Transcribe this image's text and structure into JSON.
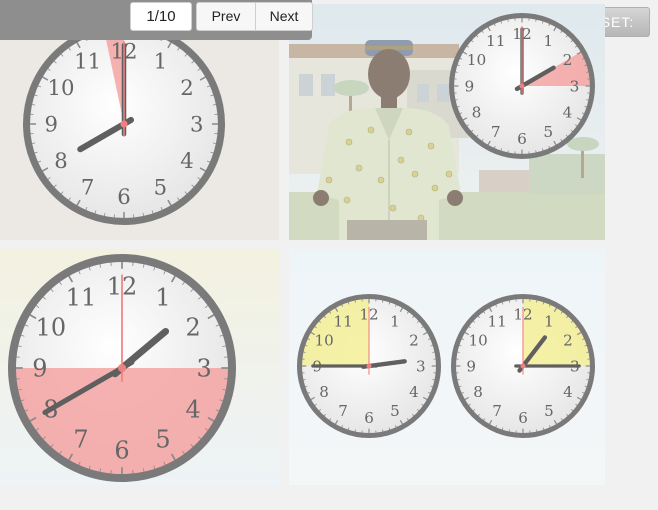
{
  "toolbar": {
    "counter": "1/10",
    "prev_label": "Prev",
    "next_label": "Next",
    "set_label": "SET:"
  },
  "colors": {
    "page_bg": "#f1f1f1",
    "toolbar_bg": "#8e8e8e",
    "clock_rim": "#7a7a7a",
    "hand": "#5f5f5f",
    "second_hand": "#f08080",
    "highlight_red": "#f4a3a3",
    "highlight_yellow": "#f3ef98"
  },
  "clock_numerals": [
    "12",
    "1",
    "2",
    "3",
    "4",
    "5",
    "6",
    "7",
    "8",
    "9",
    "10",
    "11"
  ],
  "options": [
    {
      "name": "option-1",
      "clocks": [
        {
          "time": "8:00",
          "highlight": {
            "type": "sector",
            "color": "red",
            "from_minute": 58,
            "to_minute": 60
          }
        }
      ]
    },
    {
      "name": "option-2",
      "scene": "man standing in front of a building",
      "clocks": [
        {
          "time": "2:00",
          "highlight": {
            "type": "sector",
            "color": "red",
            "from_minute": 10,
            "to_minute": 15
          }
        }
      ]
    },
    {
      "name": "option-3",
      "clocks": [
        {
          "time": "1:40",
          "highlight": {
            "type": "lower-half",
            "color": "red"
          }
        }
      ]
    },
    {
      "name": "option-4",
      "clocks": [
        {
          "time": "2:45",
          "highlight": {
            "type": "sector",
            "color": "yellow",
            "from_minute": 45,
            "to_minute": 60
          }
        },
        {
          "time": "1:15",
          "highlight": {
            "type": "sector",
            "color": "yellow",
            "from_minute": 0,
            "to_minute": 15
          }
        }
      ]
    }
  ]
}
